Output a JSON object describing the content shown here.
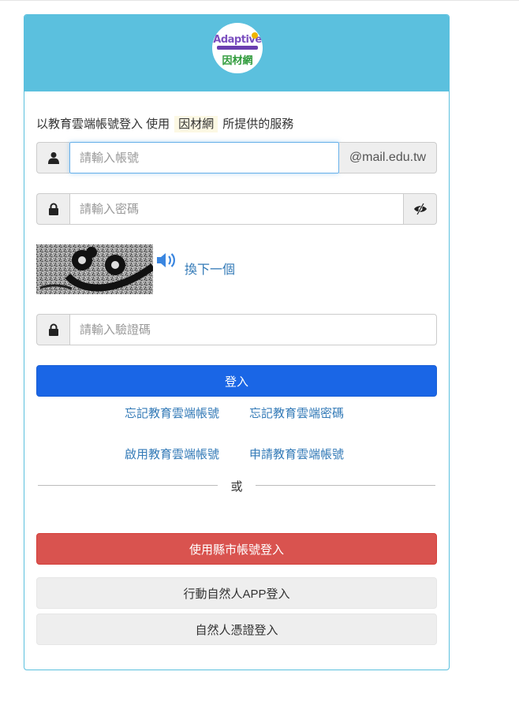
{
  "logo": {
    "brand_text": "Adaptive",
    "tagline": "Instruction & Learning",
    "name": "因材網"
  },
  "intro": {
    "prefix": "以教育雲端帳號登入 使用",
    "service": "因材網",
    "suffix": "所提供的服務"
  },
  "account": {
    "placeholder": "請輸入帳號",
    "value": "",
    "domain": "@mail.edu.tw",
    "icon": "user-icon"
  },
  "password": {
    "placeholder": "請輸入密碼",
    "value": "",
    "icon": "lock-icon",
    "toggle_icon": "eye-slash-icon"
  },
  "captcha": {
    "refresh_label": "換下一個",
    "speaker_icon": "speaker-icon"
  },
  "verify": {
    "placeholder": "請輸入驗證碼",
    "value": "",
    "icon": "lock-icon"
  },
  "login_button": "登入",
  "links": {
    "forgot_account": "忘記教育雲端帳號",
    "forgot_password": "忘記教育雲端密碼",
    "activate_account": "啟用教育雲端帳號",
    "apply_account": "申請教育雲端帳號"
  },
  "or_label": "或",
  "alt_logins": {
    "county": "使用縣市帳號登入",
    "mobile_app": "行動自然人APP登入",
    "certificate": "自然人憑證登入"
  },
  "colors": {
    "header": "#5bc0de",
    "primary": "#1a66e6",
    "danger": "#d9534f",
    "link": "#337ab7"
  }
}
